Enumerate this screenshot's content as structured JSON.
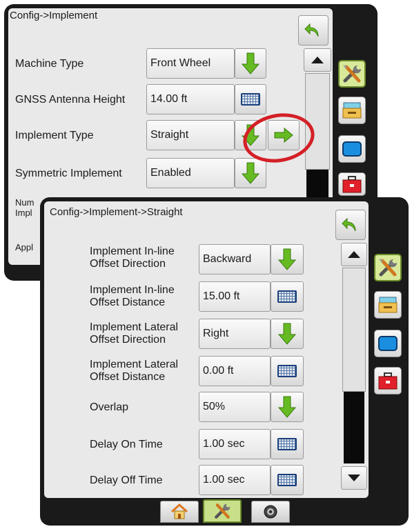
{
  "back_screen": {
    "title": "Config->Implement",
    "rows": [
      {
        "label": "Machine Type",
        "value": "Front Wheel",
        "control": "dropdown"
      },
      {
        "label": "GNSS Antenna Height",
        "value": "14.00 ft",
        "control": "keyboard"
      },
      {
        "label": "Implement Type",
        "value": "Straight",
        "control": "dropdown"
      },
      {
        "label": "Symmetric Implement",
        "value": "Enabled",
        "control": "dropdown"
      },
      {
        "label": "Num\nImpl",
        "value": "",
        "control": "dropdown"
      },
      {
        "label": "Appl",
        "value": "",
        "control": "none"
      }
    ]
  },
  "front_screen": {
    "title": "Config->Implement->Straight",
    "rows": [
      {
        "label": "Implement In-line\nOffset Direction",
        "value": "Backward",
        "control": "dropdown"
      },
      {
        "label": "Implement In-line\nOffset Distance",
        "value": "15.00 ft",
        "control": "keyboard"
      },
      {
        "label": "Implement Lateral\nOffset Direction",
        "value": "Right",
        "control": "dropdown"
      },
      {
        "label": "Implement Lateral\nOffset Distance",
        "value": "0.00 ft",
        "control": "keyboard"
      },
      {
        "label": "Overlap",
        "value": "50%",
        "control": "dropdown"
      },
      {
        "label": "Delay On Time",
        "value": "1.00 sec",
        "control": "keyboard"
      },
      {
        "label": "Delay Off Time",
        "value": "1.00 sec",
        "control": "keyboard"
      }
    ]
  },
  "side_tabs": [
    "tools-icon",
    "console-icon",
    "display-icon",
    "toolbox-icon"
  ],
  "bottom_tabs": [
    "home-icon",
    "tools-icon",
    "camera-icon"
  ],
  "colors": {
    "highlight_circle": "#d42027",
    "green_arrow": "#66bb22",
    "active_tab": "#c9e08a"
  }
}
